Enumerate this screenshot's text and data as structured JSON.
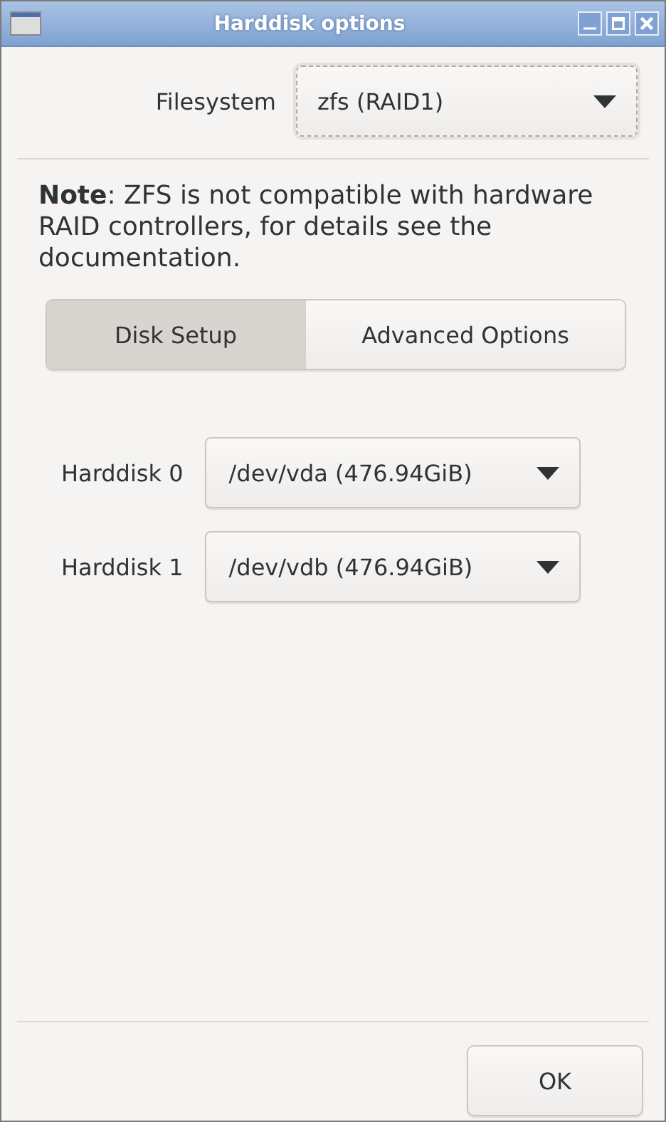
{
  "window": {
    "title": "Harddisk options"
  },
  "filesystem": {
    "label": "Filesystem",
    "value": "zfs (RAID1)"
  },
  "note": "**Note**: ZFS is not compatible with hardware RAID controllers, for details see the documentation.",
  "tabs": [
    {
      "label": "Disk Setup",
      "selected": true
    },
    {
      "label": "Advanced Options",
      "selected": false
    }
  ],
  "disks": [
    {
      "label": "Harddisk 0",
      "value": "/dev/vda (476.94GiB)"
    },
    {
      "label": "Harddisk 1",
      "value": "/dev/vdb (476.94GiB)"
    }
  ],
  "buttons": [
    "OK"
  ]
}
